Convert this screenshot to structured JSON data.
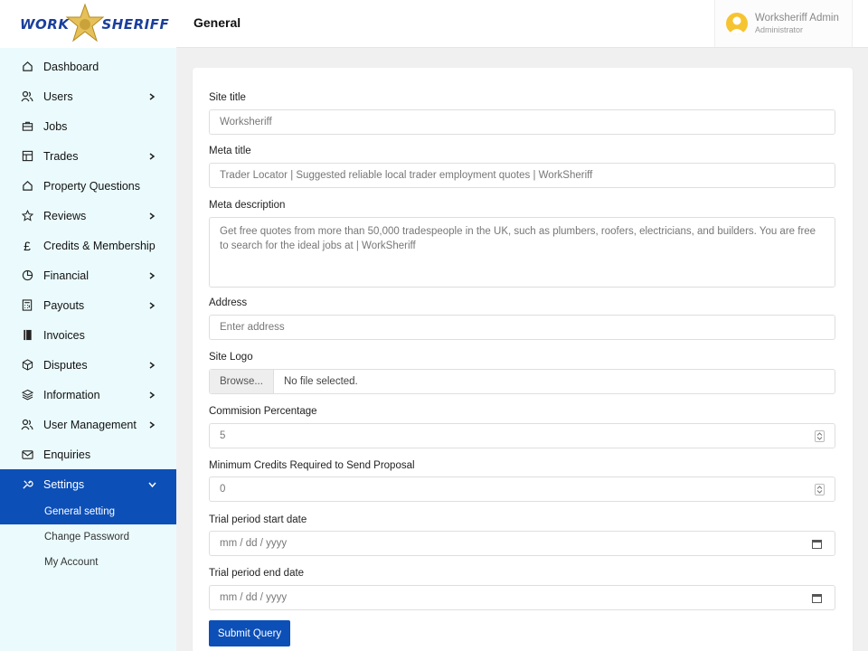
{
  "brand": {
    "left": "WORK",
    "right": "SHERIFF"
  },
  "header": {
    "title": "General"
  },
  "user": {
    "name": "Worksheriff Admin",
    "role": "Administrator"
  },
  "sidebar": {
    "items": [
      {
        "label": "Dashboard",
        "icon": "home-icon",
        "has_children": false
      },
      {
        "label": "Users",
        "icon": "users-icon",
        "has_children": true
      },
      {
        "label": "Jobs",
        "icon": "briefcase-icon",
        "has_children": false
      },
      {
        "label": "Trades",
        "icon": "grid-icon",
        "has_children": true
      },
      {
        "label": "Property Questions",
        "icon": "home-icon",
        "has_children": false
      },
      {
        "label": "Reviews",
        "icon": "star-icon",
        "has_children": true
      },
      {
        "label": "Credits & Membership",
        "icon": "pound-icon",
        "has_children": false
      },
      {
        "label": "Financial",
        "icon": "pie-chart-icon",
        "has_children": true
      },
      {
        "label": "Payouts",
        "icon": "calculator-icon",
        "has_children": true
      },
      {
        "label": "Invoices",
        "icon": "book-icon",
        "has_children": false
      },
      {
        "label": "Disputes",
        "icon": "box-icon",
        "has_children": true
      },
      {
        "label": "Information",
        "icon": "layers-icon",
        "has_children": true
      },
      {
        "label": "User Management",
        "icon": "users-icon",
        "has_children": true
      },
      {
        "label": "Enquiries",
        "icon": "mail-icon",
        "has_children": false
      },
      {
        "label": "Settings",
        "icon": "tools-icon",
        "has_children": true,
        "active": true
      }
    ],
    "sub_items": [
      {
        "label": "General setting",
        "current": true
      },
      {
        "label": "Change Password",
        "current": false
      },
      {
        "label": "My Account",
        "current": false
      }
    ]
  },
  "form": {
    "site_title": {
      "label": "Site title",
      "value": "Worksheriff"
    },
    "meta_title": {
      "label": "Meta title",
      "value": "Trader Locator | Suggested reliable local trader employment quotes | WorkSheriff"
    },
    "meta_description": {
      "label": "Meta description",
      "value": "Get free quotes from more than 50,000 tradespeople in the UK, such as plumbers, roofers, electricians, and builders. You are free to search for the ideal jobs at | WorkSheriff"
    },
    "address": {
      "label": "Address",
      "placeholder": "Enter address"
    },
    "site_logo": {
      "label": "Site Logo",
      "browse": "Browse...",
      "status": "No file selected."
    },
    "commission": {
      "label": "Commision Percentage",
      "value": "5"
    },
    "min_credits": {
      "label": "Minimum Credits Required to Send Proposal",
      "value": "0"
    },
    "trial_start": {
      "label": "Trial period start date",
      "placeholder": "mm / dd / yyyy"
    },
    "trial_end": {
      "label": "Trial period end date",
      "placeholder": "mm / dd / yyyy"
    },
    "submit_label": "Submit Query"
  },
  "colors": {
    "accent": "#0c4fb7",
    "sidebar_bg": "#ebfbfd",
    "logo_gold": "#d4a92a"
  }
}
